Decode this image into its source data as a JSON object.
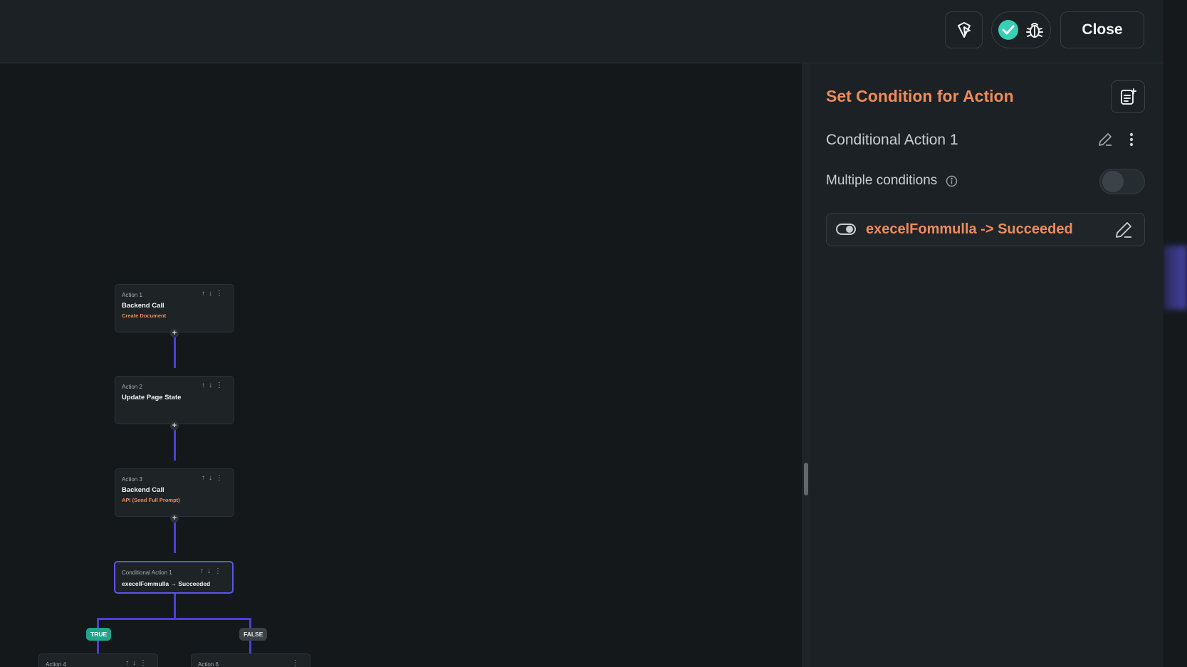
{
  "toolbar": {
    "close_label": "Close",
    "icons": [
      "cursor-logo-icon",
      "check-circle-icon",
      "bug-icon"
    ]
  },
  "panel": {
    "title": "Set Condition for Action",
    "action_name": "Conditional Action 1",
    "multiple_conditions_label": "Multiple conditions",
    "multiple_conditions_enabled": false,
    "condition_text": "execelFommulla -> Succeeded"
  },
  "flow": {
    "nodes": [
      {
        "label": "Action 1",
        "title": "Backend Call",
        "subtitle": "Create Document"
      },
      {
        "label": "Action 2",
        "title": "Update Page State",
        "subtitle": ""
      },
      {
        "label": "Action 3",
        "title": "Backend Call",
        "subtitle": "API (Send Full Prompt)"
      },
      {
        "label": "Conditional Action 1",
        "title": "execelFommulla → Succeeded",
        "subtitle": ""
      }
    ],
    "branches": {
      "true_label": "TRUE",
      "false_label": "FALSE"
    },
    "branch_nodes": [
      {
        "label": "Action 4"
      },
      {
        "label": "Action 6"
      }
    ]
  },
  "colors": {
    "accent_orange": "#ee8b5d",
    "connector_purple": "#4a3fd8",
    "true_badge": "#1fa58a",
    "selected_border": "#5b55e8"
  }
}
